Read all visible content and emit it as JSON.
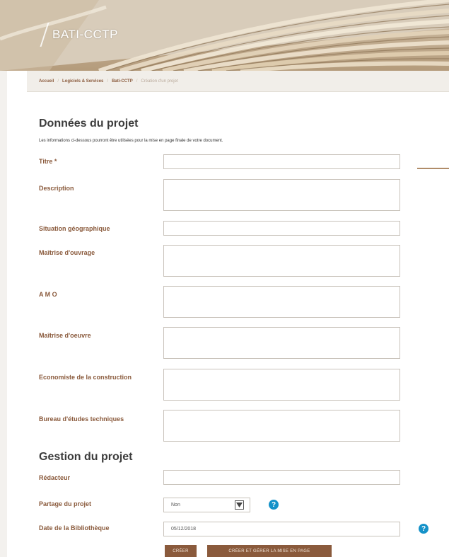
{
  "header": {
    "logo_text": "BATI-CCTP"
  },
  "breadcrumb": {
    "items": [
      "Accueil",
      "Logiciels & Services",
      "Bati-CCTP",
      "Création d'un projet"
    ]
  },
  "section_project": {
    "title": "Données du projet",
    "intro": "Les informations ci-dessous pourront être utilisées pour la mise en page finale de votre document.",
    "fields": {
      "titre": "Titre *",
      "description": "Description",
      "situation": "Situation géographique",
      "maitrise_ouvrage": "Maîtrise d'ouvrage",
      "amo": "A M O",
      "maitrise_oeuvre": "Maîtrise d'oeuvre",
      "economiste": "Economiste de la construction",
      "bureau": "Bureau d'études techniques"
    }
  },
  "section_management": {
    "title": "Gestion du projet",
    "fields": {
      "redacteur": "Rédacteur",
      "partage": "Partage du projet",
      "date_biblio": "Date de la Bibliothèque"
    },
    "partage_value": "Non",
    "date_value": "05/12/2018"
  },
  "buttons": {
    "create": "CRÉER",
    "create_and_manage": "CRÉER ET GÉRER LA MISE EN PAGE"
  },
  "help_icon_glyph": "?",
  "colors": {
    "label_brown": "#8a5a3c",
    "button_brown": "#8a5a3c",
    "help_blue": "#1592c9"
  }
}
